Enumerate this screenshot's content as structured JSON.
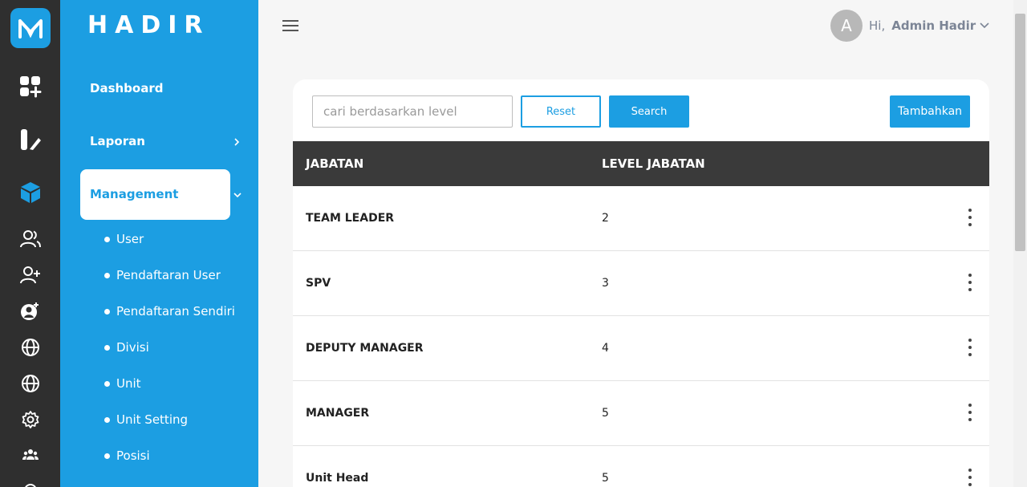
{
  "colors": {
    "accent": "#1c9ee2",
    "rail": "#2f2f2f",
    "table_header": "#3a3a3a"
  },
  "rail": {
    "icons": [
      "app-logo-icon",
      "dashboard-grid-icon",
      "report-icon",
      "management-cube-icon",
      "users-icon",
      "user-add-icon",
      "user-settings-icon",
      "globe-icon",
      "globe-icon",
      "gear-icon",
      "team-icon",
      "more-icon"
    ]
  },
  "sidebar": {
    "brand": "HADIR",
    "dashboard": "Dashboard",
    "laporan": "Laporan",
    "management": "Management",
    "sub_items": [
      {
        "label": "User"
      },
      {
        "label": "Pendaftaran User"
      },
      {
        "label": "Pendaftaran Sendiri"
      },
      {
        "label": "Divisi"
      },
      {
        "label": "Unit"
      },
      {
        "label": "Unit Setting"
      },
      {
        "label": "Posisi"
      }
    ]
  },
  "header": {
    "avatar_letter": "A",
    "greeting": "Hi,",
    "username": "Admin Hadir"
  },
  "toolbar": {
    "search_placeholder": "cari berdasarkan level",
    "search_value": "",
    "reset_label": "Reset",
    "search_label": "Search",
    "add_label": "Tambahkan"
  },
  "table": {
    "columns": [
      "JABATAN",
      "LEVEL JABATAN"
    ],
    "rows": [
      {
        "jabatan": "TEAM LEADER",
        "level": "2"
      },
      {
        "jabatan": "SPV",
        "level": "3"
      },
      {
        "jabatan": "DEPUTY MANAGER",
        "level": "4"
      },
      {
        "jabatan": "MANAGER",
        "level": "5"
      },
      {
        "jabatan": "Unit Head",
        "level": "5"
      }
    ]
  }
}
